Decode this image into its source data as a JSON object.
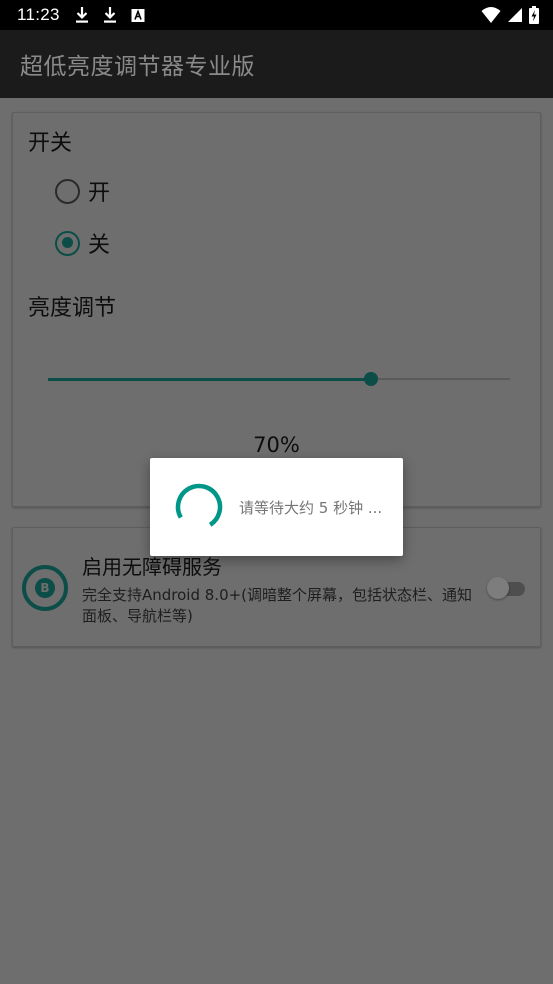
{
  "status_bar": {
    "time": "11:23",
    "left_icons": [
      "download-icon",
      "download-icon",
      "a-notification-icon"
    ],
    "right_icons": [
      "wifi-icon",
      "signal-icon",
      "battery-charging-icon"
    ]
  },
  "app_bar": {
    "title": "超低亮度调节器专业版",
    "background": "#1b1b1b"
  },
  "switch_section": {
    "title": "开关",
    "options": [
      {
        "label": "开",
        "checked": false
      },
      {
        "label": "关",
        "checked": true
      }
    ]
  },
  "brightness_section": {
    "title": "亮度调节",
    "slider_value_percent": 70,
    "value_label": "70%"
  },
  "accessibility": {
    "title": "启用无障碍服务",
    "description": "完全支持Android 8.0+(调暗整个屏幕，包括状态栏、通知面板、导航栏等)",
    "icon": "accessibility-service-icon",
    "toggle_on": false
  },
  "dialog": {
    "message": "请等待大约 5 秒钟 ..."
  },
  "colors": {
    "accent": "#009688",
    "dimmed_accent": "#0d4d48",
    "scrim": "#6e6e6e"
  }
}
